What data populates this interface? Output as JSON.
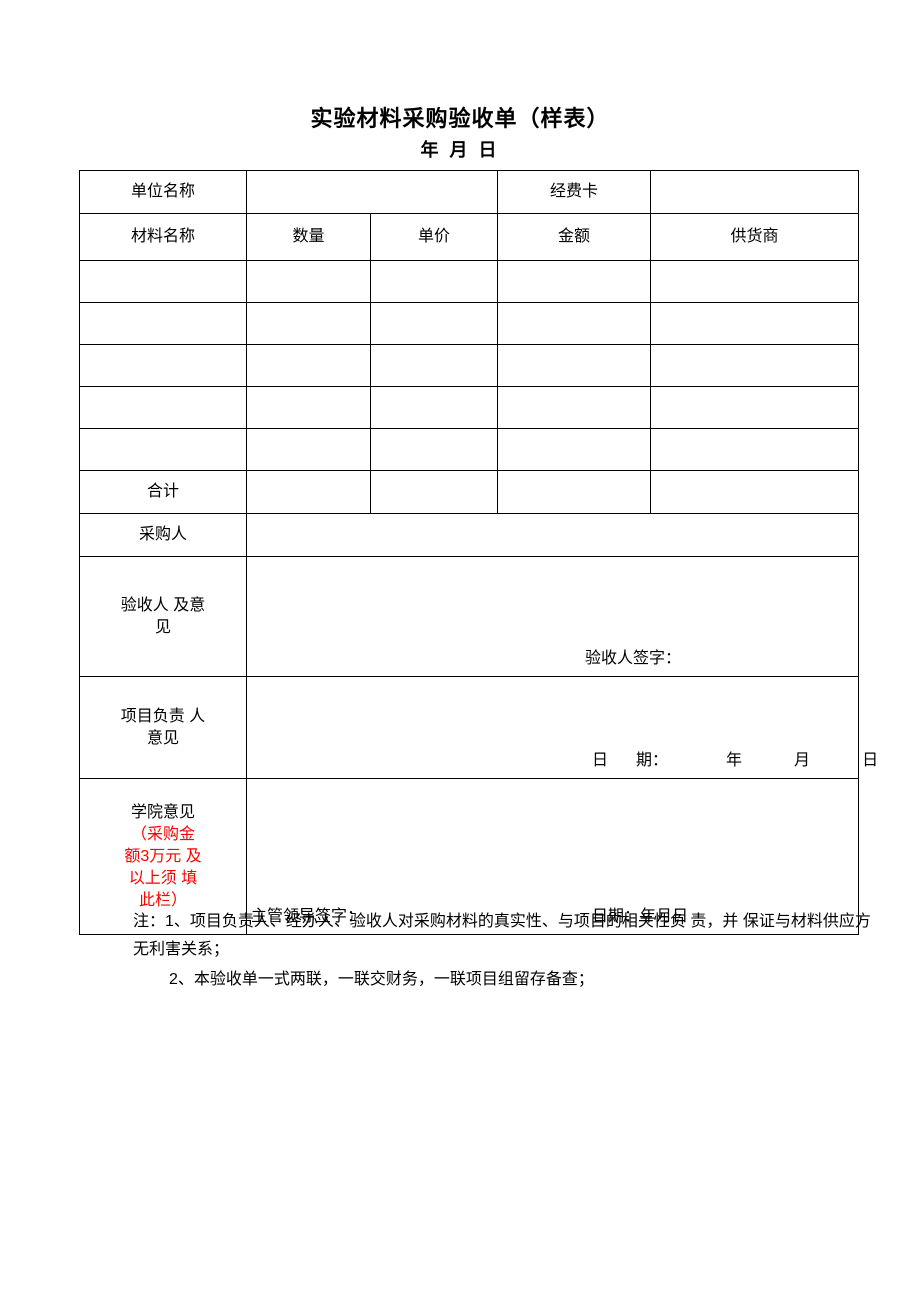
{
  "document": {
    "title": "实验材料采购验收单（样表）",
    "subtitle": "年  月  日"
  },
  "table": {
    "unit_row": {
      "label": "单位名称",
      "unit_value": "",
      "funding_card_label": "经费卡",
      "funding_card_value": ""
    },
    "column_headers": [
      "材料名称",
      "数量",
      "单价",
      "金额",
      "供货商"
    ],
    "data_rows": [
      [
        "",
        "",
        "",
        "",
        ""
      ],
      [
        "",
        "",
        "",
        "",
        ""
      ],
      [
        "",
        "",
        "",
        "",
        ""
      ],
      [
        "",
        "",
        "",
        "",
        ""
      ],
      [
        "",
        "",
        "",
        "",
        ""
      ]
    ],
    "total_row": {
      "label": "合计",
      "quantity": "",
      "unit_price": "",
      "amount": "",
      "supplier": ""
    },
    "buyer_row": {
      "label": "采购人",
      "value": ""
    },
    "inspector_section": {
      "label_line1": "验收人 及意",
      "label_line2": "见",
      "signature_label": "验收人签字："
    },
    "project_leader_section": {
      "label_line1": "项目负责 人",
      "label_line2": "意见",
      "date_label": "日",
      "date_label2": "期：",
      "year": "年",
      "month": "月",
      "day": "日"
    },
    "college_section": {
      "label": "学院意见",
      "note_line1": "（采购金",
      "note_line2": "额3万元 及",
      "note_line3": "以上须  填",
      "note_line4": "此栏）",
      "note_color": "#ff0000",
      "signature_label": "主管领导签字：",
      "date_label": "日",
      "date_label2": "期：",
      "year": "年",
      "month": "月",
      "day": "日"
    }
  },
  "notes": {
    "line1": "注：1、项目负责人、经办人、验收人对采购材料的真实性、与项目的相关性负  责，并",
    "line1b": "保证与材料供应方无利害关系；",
    "line2": "2、本验收单一式两联，一联交财务，一联项目组留存备查；"
  }
}
